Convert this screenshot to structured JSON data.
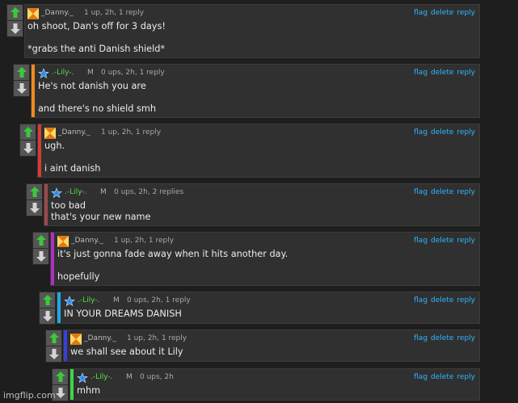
{
  "colors": {
    "background": "#1e1e1e",
    "card": "#303030",
    "link": "#2db7ff",
    "upvote": "#3cc83c"
  },
  "icons": {
    "upvote": "up-arrow-icon",
    "downvote": "down-arrow-icon",
    "danny_avatar": "checkered-avatar-icon",
    "lily_avatar": "blue-star-avatar-icon"
  },
  "actions": {
    "flag": "flag",
    "delete": "delete",
    "reply": "reply"
  },
  "comments": [
    {
      "user": "_Danny._",
      "mod": "",
      "meta": "1 up, 2h, 1 reply",
      "bar_color": "",
      "lines": [
        "oh shoot, Dan's off for 3 days!",
        "",
        "*grabs the anti Danish shield*"
      ]
    },
    {
      "user": ".-Lily-.",
      "mod": "M",
      "meta": "0 ups, 2h, 1 reply",
      "bar_color": "#f08a1e",
      "lines": [
        "He's not danish you are",
        "",
        "and there's no shield smh"
      ]
    },
    {
      "user": "_Danny._",
      "mod": "",
      "meta": "1 up, 2h, 1 reply",
      "bar_color": "#d83a3a",
      "lines": [
        "ugh.",
        "",
        "i aint danish"
      ]
    },
    {
      "user": ".-Lily-.",
      "mod": "M",
      "meta": "0 ups, 2h, 2 replies",
      "bar_color": "#9b4a4a",
      "lines": [
        "too bad",
        "that's your new name"
      ]
    },
    {
      "user": "_Danny._",
      "mod": "",
      "meta": "1 up, 2h, 1 reply",
      "bar_color": "#b12ec4",
      "lines": [
        "it's just gonna fade away when it hits another day.",
        "",
        "hopefully"
      ]
    },
    {
      "user": ".-Lily-.",
      "mod": "M",
      "meta": "0 ups, 2h, 1 reply",
      "bar_color": "#1fa8e6",
      "lines": [
        "IN YOUR DREAMS DANISH"
      ]
    },
    {
      "user": "_Danny._",
      "mod": "",
      "meta": "1 up, 2h, 1 reply",
      "bar_color": "#3a3fd8",
      "lines": [
        "we shall see about it Lily"
      ]
    },
    {
      "user": ".-Lily-.",
      "mod": "M",
      "meta": "0 ups, 2h",
      "bar_color": "#3fd34a",
      "lines": [
        "mhm"
      ]
    }
  ],
  "watermark": "imgflip.com"
}
